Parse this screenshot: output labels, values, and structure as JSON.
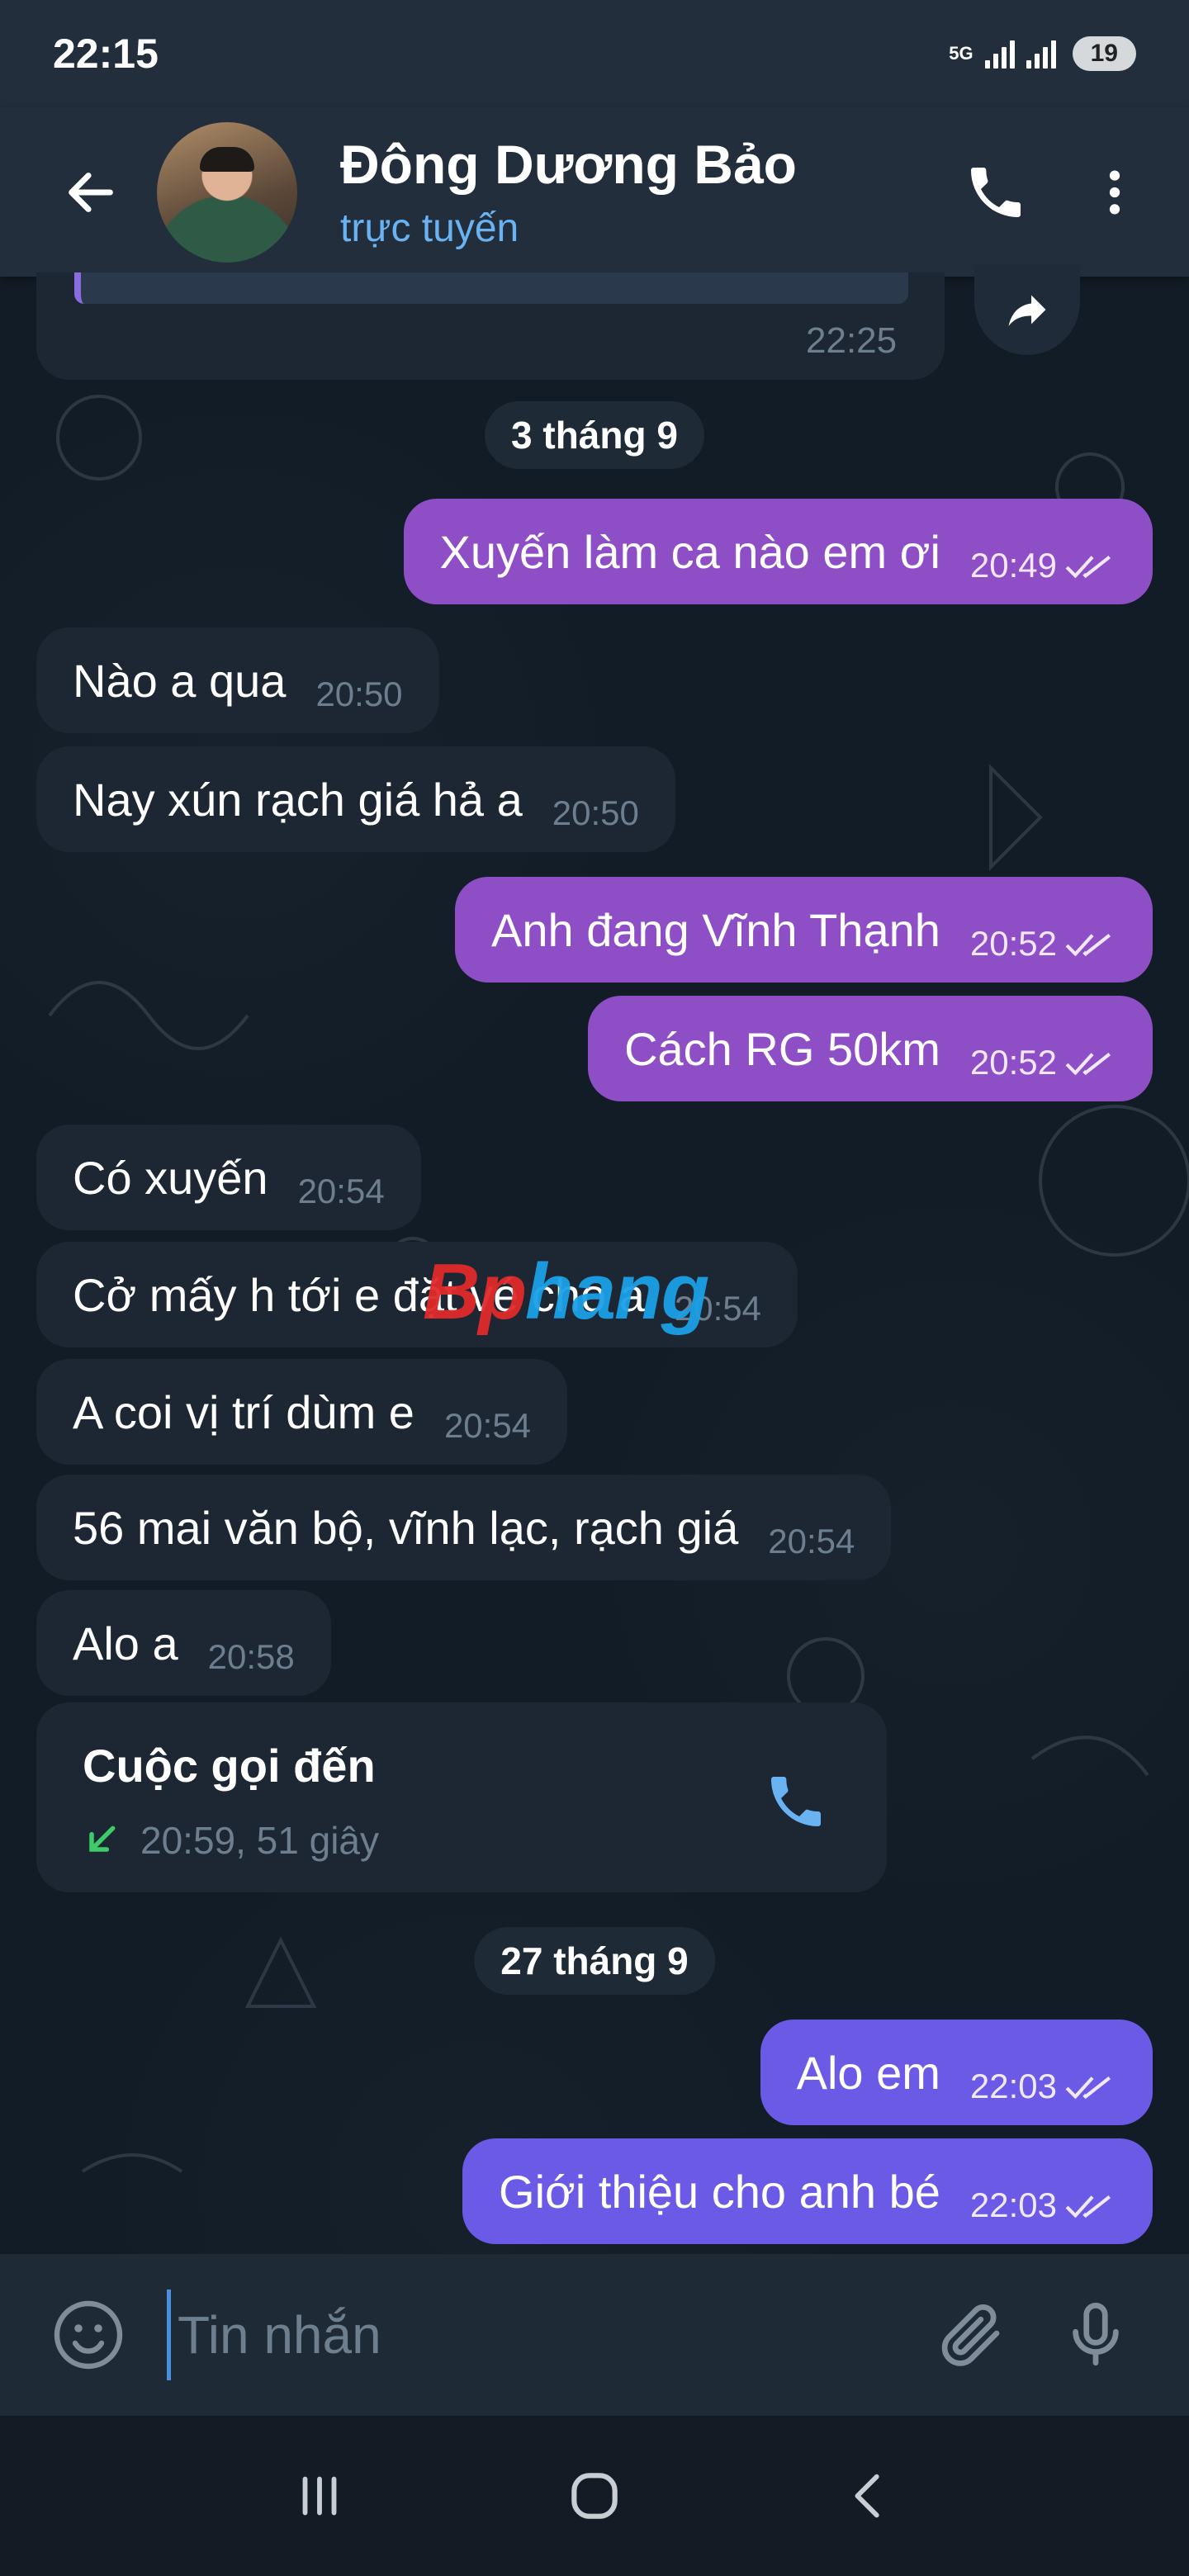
{
  "status": {
    "time": "22:15",
    "network": "5G",
    "battery": "19"
  },
  "header": {
    "name": "Đông Dương Bảo",
    "presence": "trực tuyến"
  },
  "top_partial": {
    "time": "22:25"
  },
  "dates": {
    "d1": "3 tháng 9",
    "d2": "27 tháng 9"
  },
  "messages": [
    {
      "dir": "out",
      "text": "Xuyến làm ca nào em ơi",
      "time": "20:49"
    },
    {
      "dir": "in",
      "text": "Nào a qua",
      "time": "20:50"
    },
    {
      "dir": "in",
      "text": "Nay xún rạch giá hả a",
      "time": "20:50"
    },
    {
      "dir": "out",
      "text": "Anh đang Vĩnh Thạnh",
      "time": "20:52"
    },
    {
      "dir": "out",
      "text": "Cách RG 50km",
      "time": "20:52"
    },
    {
      "dir": "in",
      "text": "Có xuyến",
      "time": "20:54"
    },
    {
      "dir": "in",
      "text": "Cở mấy h tới e đặt vé cho a",
      "time": "20:54"
    },
    {
      "dir": "in",
      "text": "A coi vị trí dùm e",
      "time": "20:54"
    },
    {
      "dir": "in",
      "text": "56 mai văn bộ, vĩnh lạc, rạch giá",
      "time": "20:54"
    },
    {
      "dir": "in",
      "text": "Alo a",
      "time": "20:58"
    },
    {
      "dir": "out",
      "text": "Alo em",
      "time": "22:03"
    },
    {
      "dir": "out",
      "text": "Giới thiệu cho anh bé",
      "time": "22:03"
    }
  ],
  "call": {
    "title": "Cuộc gọi đến",
    "detail": "20:59, 51 giây"
  },
  "watermark": {
    "part1": "Bp",
    "part2": "hang"
  },
  "input": {
    "placeholder": "Tin nhắn"
  },
  "colors": {
    "header": "#232e3c",
    "outgoing_purple": "#8e4ec6",
    "outgoing_blue": "#6a5ae6",
    "incoming": "#1c2733",
    "accent": "#6ab3f3"
  },
  "icons": [
    "back-arrow",
    "phone",
    "more-vertical",
    "share-forward",
    "double-check",
    "incoming-call-arrow",
    "emoji",
    "attachment",
    "microphone",
    "recents",
    "home",
    "back"
  ]
}
